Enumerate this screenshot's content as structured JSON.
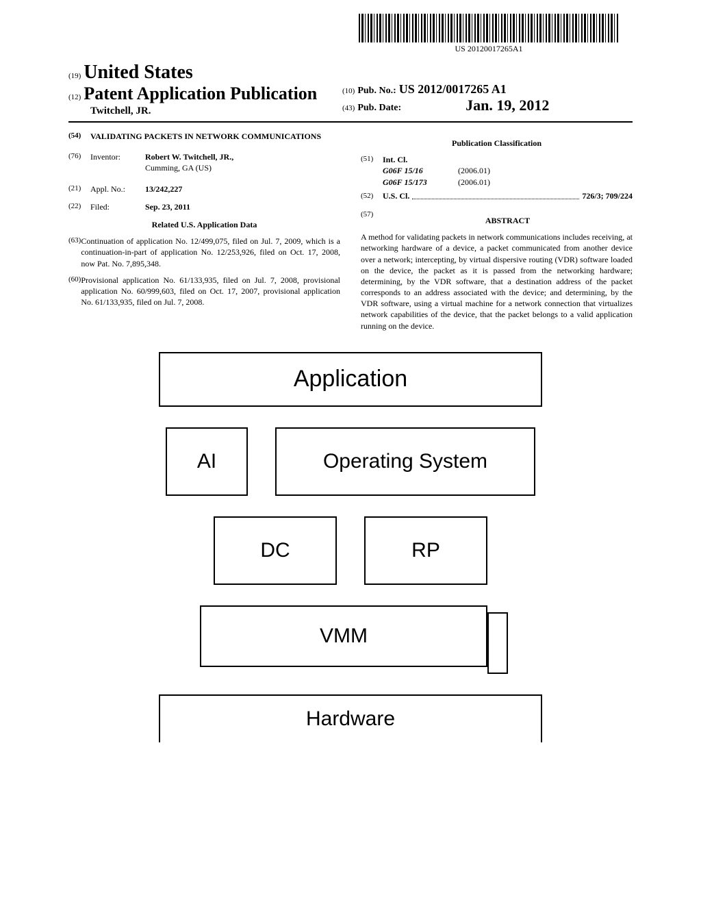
{
  "barcode_text": "US 20120017265A1",
  "header": {
    "code19": "(19)",
    "country": "United States",
    "code12": "(12)",
    "pub_type": "Patent Application Publication",
    "author": "Twitchell, JR.",
    "code10": "(10)",
    "pub_no_label": "Pub. No.:",
    "pub_no": "US 2012/0017265 A1",
    "code43": "(43)",
    "pub_date_label": "Pub. Date:",
    "pub_date": "Jan. 19, 2012"
  },
  "left": {
    "code54": "(54)",
    "title": "VALIDATING PACKETS IN NETWORK COMMUNICATIONS",
    "code76": "(76)",
    "inventor_label": "Inventor:",
    "inventor_name": "Robert W. Twitchell, JR.,",
    "inventor_loc": "Cumming, GA (US)",
    "code21": "(21)",
    "appl_label": "Appl. No.:",
    "appl_no": "13/242,227",
    "code22": "(22)",
    "filed_label": "Filed:",
    "filed_date": "Sep. 23, 2011",
    "related_title": "Related U.S. Application Data",
    "code63": "(63)",
    "continuation": "Continuation of application No. 12/499,075, filed on Jul. 7, 2009, which is a continuation-in-part of application No. 12/253,926, filed on Oct. 17, 2008, now Pat. No. 7,895,348.",
    "code60": "(60)",
    "provisional": "Provisional application No. 61/133,935, filed on Jul. 7, 2008, provisional application No. 60/999,603, filed on Oct. 17, 2007, provisional application No. 61/133,935, filed on Jul. 7, 2008."
  },
  "right": {
    "classification_title": "Publication Classification",
    "code51": "(51)",
    "intcl_label": "Int. Cl.",
    "intcl1_code": "G06F 15/16",
    "intcl1_ver": "(2006.01)",
    "intcl2_code": "G06F 15/173",
    "intcl2_ver": "(2006.01)",
    "code52": "(52)",
    "uscl_label": "U.S. Cl.",
    "uscl_value": "726/3; 709/224",
    "code57": "(57)",
    "abstract_label": "ABSTRACT",
    "abstract_text": "A method for validating packets in network communications includes receiving, at networking hardware of a device, a packet communicated from another device over a network; intercepting, by virtual dispersive routing (VDR) software loaded on the device, the packet as it is passed from the networking hardware; determining, by the VDR software, that a destination address of the packet corresponds to an address associated with the device; and determining, by the VDR software, using a virtual machine for a network connection that virtualizes network capabilities of the device, that the packet belongs to a valid application running on the device."
  },
  "diagram": {
    "application": "Application",
    "ai": "AI",
    "os": "Operating System",
    "dc": "DC",
    "rp": "RP",
    "vmm": "VMM",
    "hardware": "Hardware"
  }
}
